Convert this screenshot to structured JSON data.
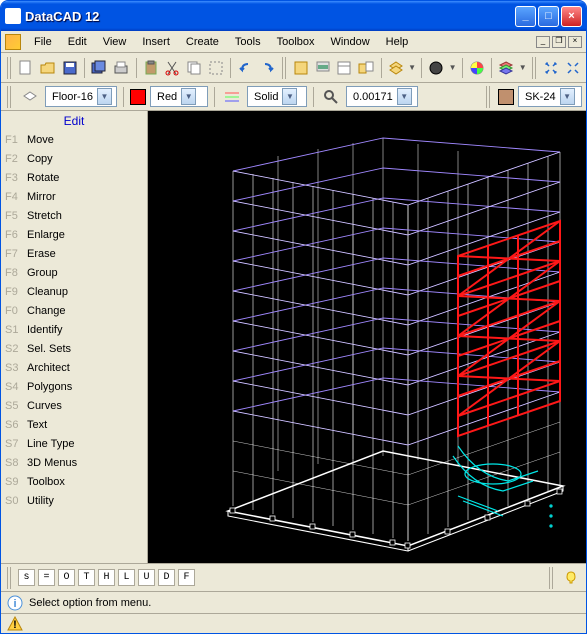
{
  "title": "DataCAD 12",
  "menus": [
    "File",
    "Edit",
    "View",
    "Insert",
    "Create",
    "Tools",
    "Toolbox",
    "Window",
    "Help"
  ],
  "toolbar2": {
    "layer_value": "Floor-16",
    "color_value": "Red",
    "linetype_value": "Solid",
    "scale_value": "0.00171",
    "material_value": "SK-24"
  },
  "sidebar": {
    "title": "Edit",
    "items": [
      {
        "key": "F1",
        "label": "Move"
      },
      {
        "key": "F2",
        "label": "Copy"
      },
      {
        "key": "F3",
        "label": "Rotate"
      },
      {
        "key": "F4",
        "label": "Mirror"
      },
      {
        "key": "F5",
        "label": "Stretch"
      },
      {
        "key": "F6",
        "label": "Enlarge"
      },
      {
        "key": "F7",
        "label": "Erase"
      },
      {
        "key": "F8",
        "label": "Group"
      },
      {
        "key": "F9",
        "label": "Cleanup"
      },
      {
        "key": "F0",
        "label": "Change"
      },
      {
        "key": "S1",
        "label": "Identify"
      },
      {
        "key": "S2",
        "label": "Sel. Sets"
      },
      {
        "key": "S3",
        "label": "Architect"
      },
      {
        "key": "S4",
        "label": "Polygons"
      },
      {
        "key": "S5",
        "label": "Curves"
      },
      {
        "key": "S6",
        "label": "Text"
      },
      {
        "key": "S7",
        "label": "Line Type"
      },
      {
        "key": "S8",
        "label": "3D Menus"
      },
      {
        "key": "S9",
        "label": "Toolbox"
      },
      {
        "key": "S0",
        "label": "Utility"
      }
    ]
  },
  "swat_row": [
    "s",
    "=",
    "O",
    "T",
    "H",
    "L",
    "U",
    "D",
    "F"
  ],
  "status": "Select option from menu."
}
